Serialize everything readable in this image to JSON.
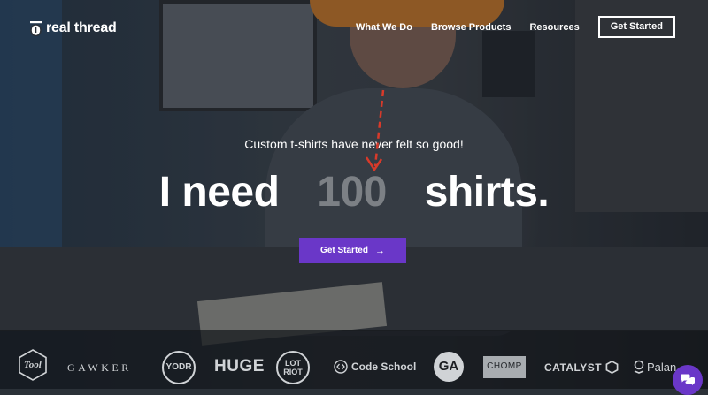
{
  "nav": {
    "brand": "real thread",
    "links": [
      "What We Do",
      "Browse Products",
      "Resources"
    ],
    "cta": "Get Started"
  },
  "hero": {
    "tagline": "Custom t-shirts have never felt so good!",
    "headline_prefix": "I need",
    "headline_number": "100",
    "headline_suffix": "shirts.",
    "button_label": "Get Started",
    "button_arrow": "→"
  },
  "client_logos": {
    "tool": "Tool",
    "gawker": "GAWKER",
    "yoder": "YODR",
    "huge": "HUGE",
    "lot_riot": "LOT RIOT",
    "code_school": "Code School",
    "ga": "GA",
    "chomp": "CHOMP",
    "catalyst": "CATALYST",
    "palantir": "Palan"
  },
  "colors": {
    "accent": "#6a37c8",
    "text": "#ffffff"
  },
  "icons": [
    "real-thread-logo-icon",
    "arrow-right-icon",
    "chat-icon"
  ]
}
